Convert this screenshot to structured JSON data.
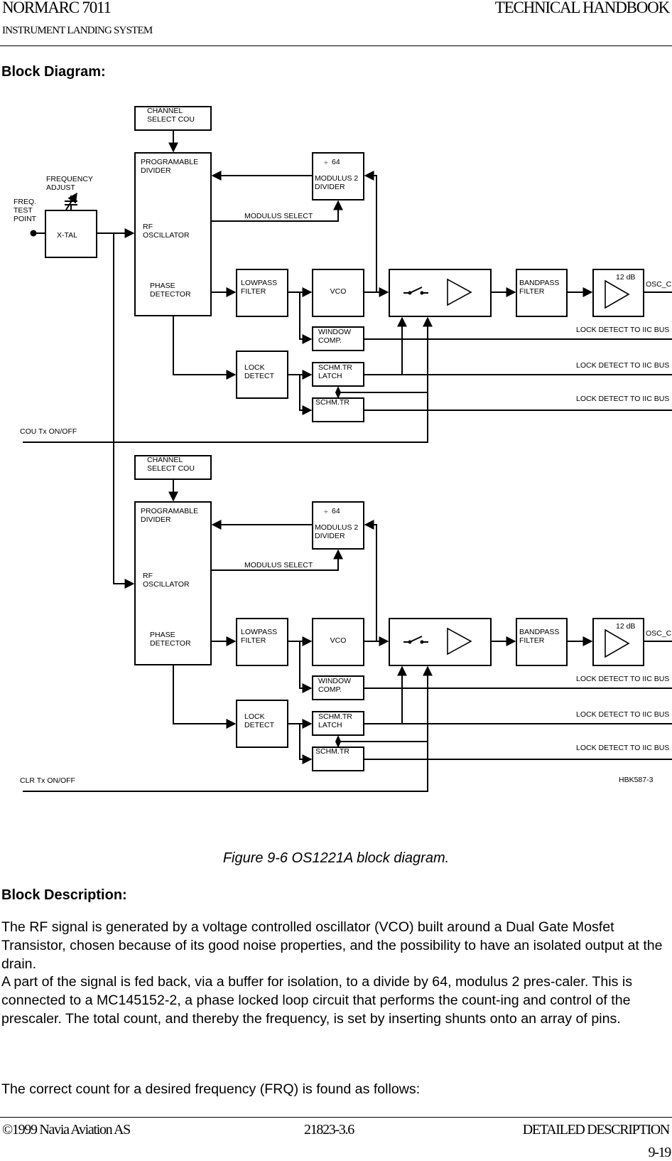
{
  "header": {
    "product": "NORMARC 7011",
    "doc_type": "TECHNICAL HANDBOOK",
    "subtitle": "INSTRUMENT LANDING SYSTEM"
  },
  "sections": {
    "block_diagram_heading": "Block Diagram:",
    "block_description_heading": "Block Description:"
  },
  "diagram": {
    "shared": {
      "xtal": "X-TAL",
      "freq_adjust": [
        "FREQUENCY",
        "ADJUST"
      ],
      "test_point": [
        "FREQ.",
        "TEST",
        "POINT"
      ],
      "drawing_id": "HBK587-3"
    },
    "channels": [
      {
        "channel_select": [
          "CHANNEL",
          "SELECT COU"
        ],
        "prog_divider": [
          "PROGRAMABLE",
          "DIVIDER"
        ],
        "rf_osc": [
          "RF",
          "OSCILLATOR"
        ],
        "phase_det": [
          "PHASE",
          "DETECTOR"
        ],
        "divider_ratio": "64",
        "modulus_divider": [
          "MODULUS 2",
          "DIVIDER"
        ],
        "modulus_select": "MODULUS SELECT",
        "lowpass": [
          "LOWPASS",
          "FILTER"
        ],
        "vco": "VCO",
        "bandpass": [
          "BANDPASS",
          "FILTER"
        ],
        "amp_gain": "12 dB",
        "output": "OSC_C",
        "window_comp": [
          "WINDOW",
          "COMP."
        ],
        "lock_detect": [
          "LOCK",
          "DETECT"
        ],
        "schm_latch": [
          "SCHM.TR",
          "LATCH"
        ],
        "schm": "SCHM.TR",
        "iic_labels": [
          "LOCK DETECT TO IIC BUS",
          "LOCK DETECT TO IIC BUS",
          "LOCK DETECT TO IIC BUS"
        ],
        "tx_onoff": "COU Tx ON/OFF"
      },
      {
        "channel_select": [
          "CHANNEL",
          "SELECT COU"
        ],
        "prog_divider": [
          "PROGRAMABLE",
          "DIVIDER"
        ],
        "rf_osc": [
          "RF",
          "OSCILLATOR"
        ],
        "phase_det": [
          "PHASE",
          "DETECTOR"
        ],
        "divider_ratio": "64",
        "modulus_divider": [
          "MODULUS 2",
          "DIVIDER"
        ],
        "modulus_select": "MODULUS SELECT",
        "lowpass": [
          "LOWPASS",
          "FILTER"
        ],
        "vco": "VCO",
        "bandpass": [
          "BANDPASS",
          "FILTER"
        ],
        "amp_gain": "12 dB",
        "output": "OSC_C",
        "window_comp": [
          "WINDOW",
          "COMP."
        ],
        "lock_detect": [
          "LOCK",
          "DETECT"
        ],
        "schm_latch": [
          "SCHM.TR",
          "LATCH"
        ],
        "schm": "SCHM.TR",
        "iic_labels": [
          "LOCK DETECT TO IIC BUS",
          "LOCK DETECT TO IIC BUS",
          "LOCK DETECT TO IIC BUS"
        ],
        "tx_onoff": "CLR  Tx ON/OFF"
      }
    ]
  },
  "caption": "Figure 9-6 OS1221A block diagram.",
  "paragraphs": [
    "The RF signal is generated by a voltage controlled oscillator (VCO) built around a Dual Gate Mosfet Transistor, chosen because of its good noise properties, and the possibility to have an isolated output at the drain.",
    "A part of the signal is fed back, via a buffer for isolation, to a divide by 64, modulus 2 pres-caler. This is connected to a MC145152-2, a phase locked loop circuit that performs the count-ing and control of the prescaler. The total count, and thereby the frequency, is set by inserting shunts onto an array of pins.",
    "The correct count for a desired frequency (FRQ) is found as follows:"
  ],
  "footer": {
    "copyright": "©1999 Navia Aviation AS",
    "doc_number": "21823-3.6",
    "section": "DETAILED DESCRIPTION",
    "page": "9-19"
  }
}
